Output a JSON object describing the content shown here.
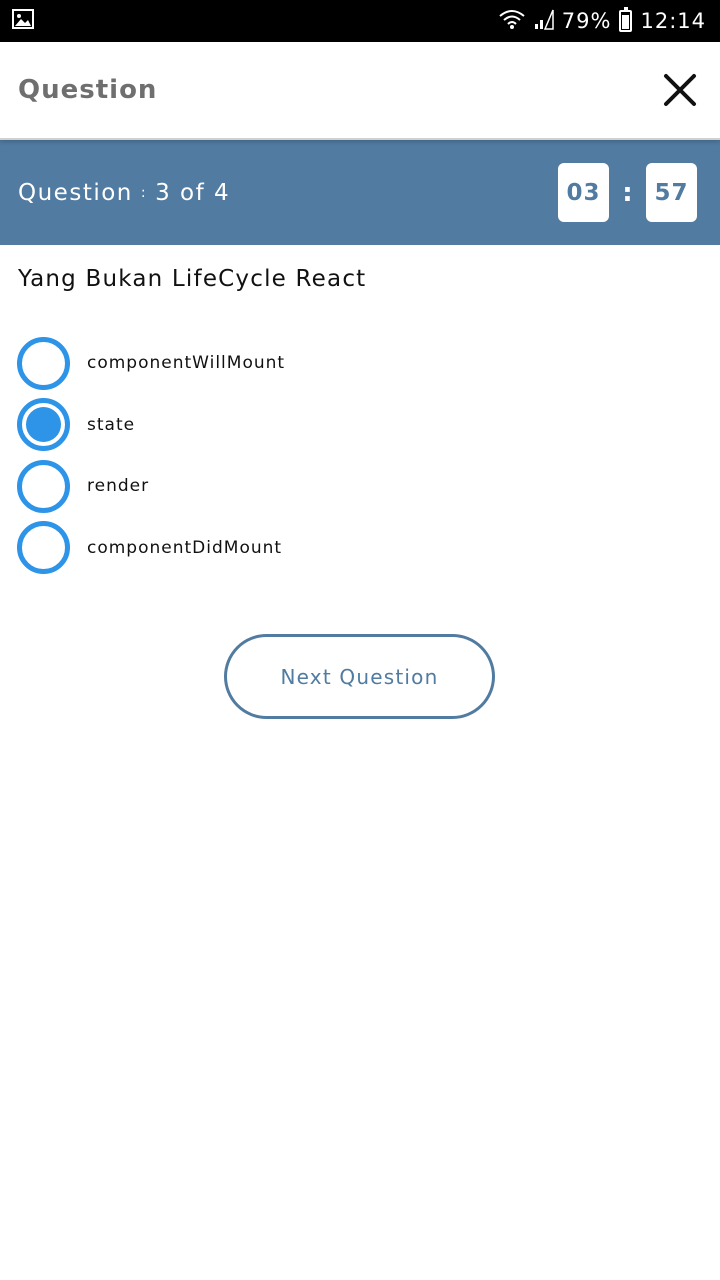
{
  "status_bar": {
    "battery": "79%",
    "time": "12:14",
    "icons": [
      "image-icon",
      "wifi-icon",
      "signal-icon",
      "battery-icon"
    ]
  },
  "app_bar": {
    "title": "Question",
    "close_icon": "close-icon"
  },
  "question_bar": {
    "label": "Question",
    "separator": ":",
    "counter": "3 of 4",
    "timer": {
      "minutes": "03",
      "colon": ":",
      "seconds": "57"
    }
  },
  "question": {
    "text": "Yang Bukan LifeCycle React",
    "options": [
      {
        "label": "componentWillMount",
        "selected": false
      },
      {
        "label": "state",
        "selected": true
      },
      {
        "label": "render",
        "selected": false
      },
      {
        "label": "componentDidMount",
        "selected": false
      }
    ]
  },
  "next_button": {
    "label": "Next Question"
  },
  "colors": {
    "accent": "#517ba0",
    "radio": "#2d94e8"
  }
}
